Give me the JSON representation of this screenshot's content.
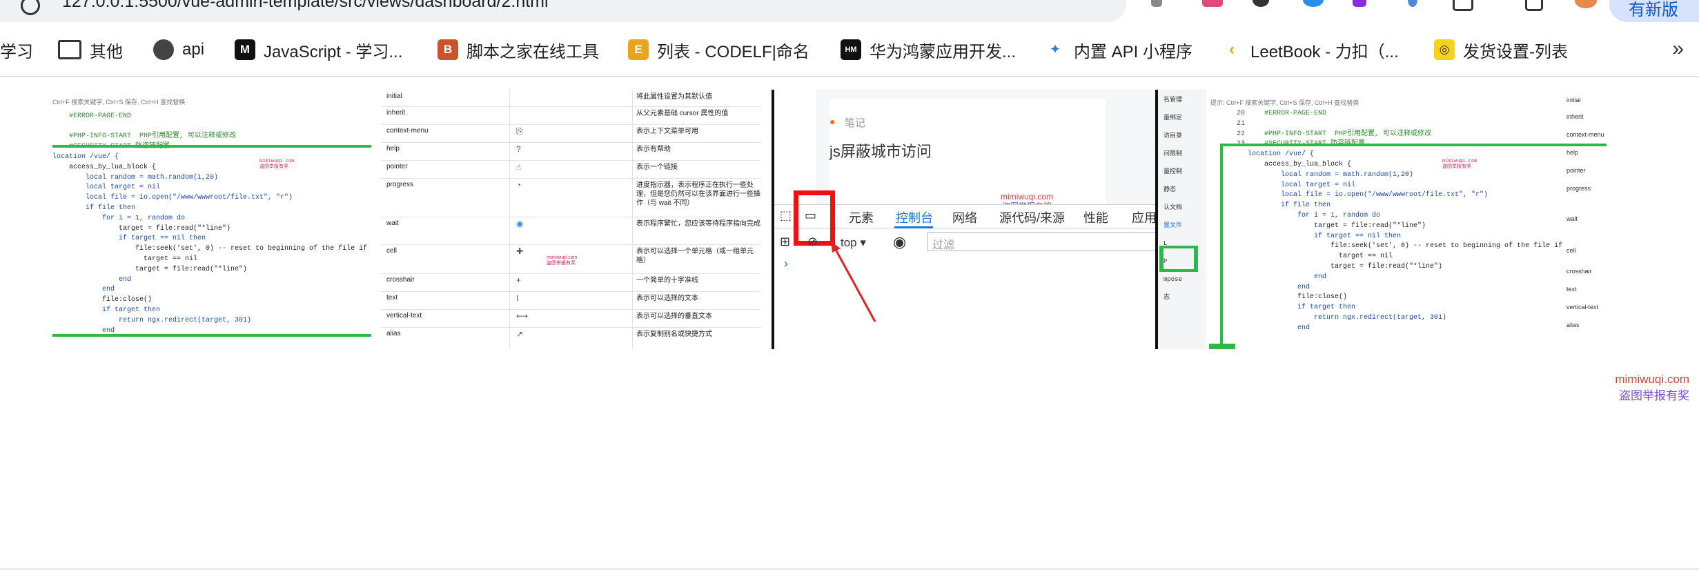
{
  "browser": {
    "url": "127.0.0.1:5500/vue-admin-template/src/views/dashboard/2.html",
    "update_label": "有新版",
    "omnibox_icons": [
      "translate-icon",
      "star-icon"
    ],
    "extension_icons": [
      "extension-filter-icon",
      "extension-ca-icon",
      "extension-circles-icon",
      "extension-compass-icon",
      "extension-purple-icon",
      "extension-blue-icon",
      "extension-square-icon",
      "tab-grid-icon",
      "profile-avatar-icon"
    ]
  },
  "bookmarks": {
    "items": [
      {
        "label": "学习",
        "icon": "page-icon"
      },
      {
        "label": "其他",
        "icon": "folder-icon"
      },
      {
        "label": "api",
        "icon": "globe-icon"
      },
      {
        "label": "JavaScript - 学习...",
        "icon": "mdn-icon"
      },
      {
        "label": "脚本之家在线工具",
        "icon": "jb51-icon"
      },
      {
        "label": "列表 - CODELF|命名",
        "icon": "codelf-icon"
      },
      {
        "label": "华为鸿蒙应用开发...",
        "icon": "hmos-icon"
      },
      {
        "label": "内置 API 小程序",
        "icon": "miniprogram-icon"
      },
      {
        "label": "LeetBook - 力扣（...",
        "icon": "leetcode-icon"
      },
      {
        "label": "发货设置-列表",
        "icon": "shipping-icon"
      }
    ],
    "more_label": "»"
  },
  "images": {
    "editor1": {
      "hint": "Ctrl+F 搜索关键字, Ctrl+S 保存, Ctrl+H 查找替换",
      "lines": [
        "    #ERROR-PAGE-END",
        "",
        "    #PHP-INFO-START  PHP引用配置, 可以注释或修改",
        "    #SECURITY-START 防盗链配置",
        "location /vue/ {",
        "    access_by_lua_block {",
        "        local random = math.random(1,20)",
        "        local target = nil",
        "        local file = io.open(\"/www/wwwroot/file.txt\", \"r\")",
        "        if file then",
        "            for i = 1, random do",
        "                target = file:read(\"*line\")",
        "                if target == nil then",
        "                    file:seek('set', 0) -- reset to beginning of the file if",
        "                      target == nil",
        "                    target = file:read(\"*line\")",
        "                end",
        "            end",
        "            file:close()",
        "            if target then",
        "                return ngx.redirect(target, 301)",
        "            end"
      ]
    },
    "cursor_table": {
      "rows": [
        {
          "name": "initial",
          "icon": "",
          "desc": "将此属性设置为其默认值"
        },
        {
          "name": "inherit",
          "icon": "",
          "desc": "从父元素基础 cursor 属性的值"
        },
        {
          "name": "context-menu",
          "icon": "⎘",
          "desc": "表示上下文菜单可用"
        },
        {
          "name": "help",
          "icon": "?",
          "desc": "表示有帮助"
        },
        {
          "name": "pointer",
          "icon": "☝",
          "desc": "表示一个链接"
        },
        {
          "name": "progress",
          "icon": "◔",
          "desc": "进度指示器，表示程序正在执行一些处理，但是您仍然可以在该界面进行一些操作（与 wait 不同）"
        },
        {
          "name": "wait",
          "icon": "◉",
          "desc": "表示程序繁忙，您应该等待程序指向完成"
        },
        {
          "name": "cell",
          "icon": "✚",
          "desc": "表示可以选择一个单元格（或一组单元格）"
        },
        {
          "name": "crosshair",
          "icon": "+",
          "desc": "一个简单的十字准线"
        },
        {
          "name": "text",
          "icon": "I",
          "desc": "表示可以选择的文本"
        },
        {
          "name": "vertical-text",
          "icon": "⟷",
          "desc": "表示可以选择的垂直文本"
        },
        {
          "name": "alias",
          "icon": "↗",
          "desc": "表示复制别名或快捷方式"
        }
      ]
    },
    "devtools": {
      "note_label": "笔记",
      "note_title": "js屏蔽城市访问",
      "watermark_lines": [
        "mimiwuqi.com",
        "盗图举报有奖"
      ],
      "tabs": [
        "元素",
        "控制台",
        "网络",
        "源代码/来源",
        "性能",
        "应用"
      ],
      "active_tab": "控制台",
      "context_select": "top",
      "filter_placeholder": "过滤",
      "prompt": "›"
    },
    "editor2": {
      "hint": "提示: Ctrl+F 搜索关键字, Ctrl+S 保存, Ctrl+H 查找替换",
      "line_numbers": [
        "20",
        "21",
        "22",
        "23"
      ],
      "side_menu": [
        "名管理",
        "量绑定",
        "访目录",
        "问限制",
        "量控制",
        "静态",
        "认文档",
        "置文件",
        "L",
        "P",
        "mpose",
        "志"
      ],
      "active_menu": "置文件",
      "right_list": [
        "initial",
        "inherit",
        "context-menu",
        "help",
        "pointer",
        "progress",
        "wait",
        "cell",
        "crosshair",
        "text",
        "vertical-text",
        "alias"
      ]
    },
    "tiny_watermark": [
      "mimiwuqi.com",
      "盗图举报有奖"
    ]
  },
  "page_watermark": {
    "line1": "mimiwuqi.com",
    "line2": "盗图举报有奖"
  },
  "colors": {
    "accent": "#1a73e8",
    "highlight_red": "#f01010",
    "highlight_green": "#2db84a",
    "watermark_red": "#d6453a",
    "watermark_purple": "#7a4bd6"
  }
}
